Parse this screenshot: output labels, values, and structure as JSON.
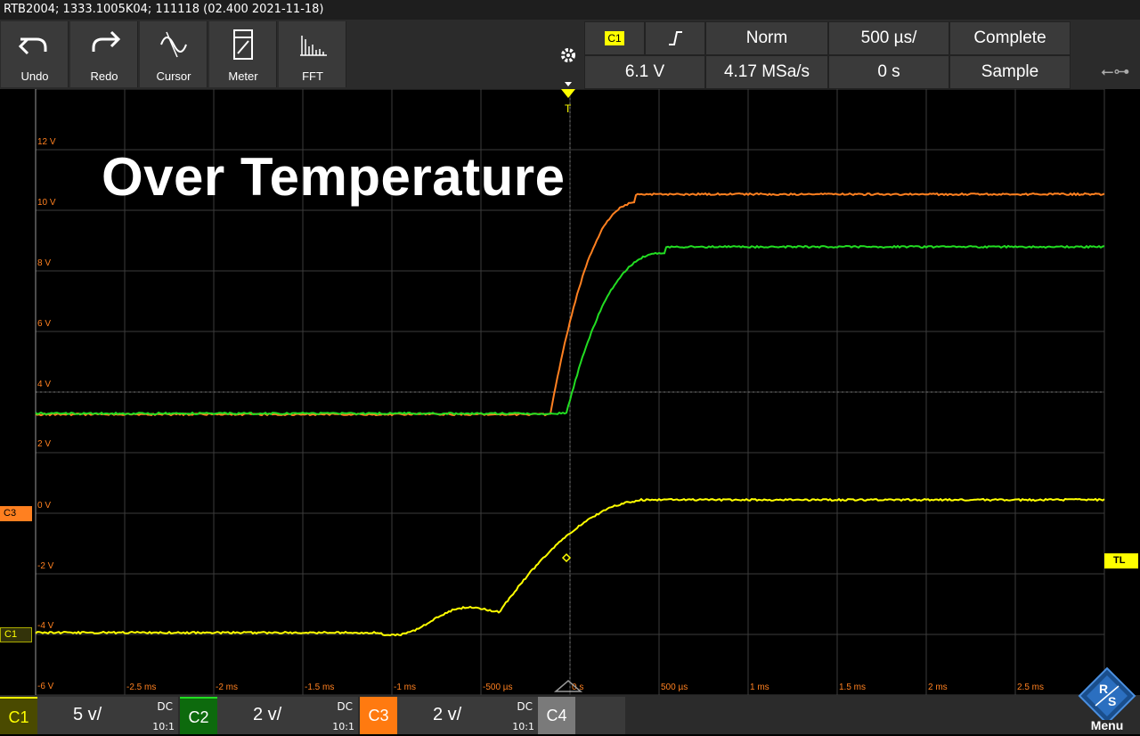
{
  "titlebar": {
    "text": "RTB2004; 1333.1005K04; 111118 (02.400 2021-11-18)"
  },
  "toolbar": {
    "buttons": [
      {
        "label": "Undo",
        "icon": "undo-icon"
      },
      {
        "label": "Redo",
        "icon": "redo-icon"
      },
      {
        "label": "Cursor",
        "icon": "cursor-icon"
      },
      {
        "label": "Meter",
        "icon": "meter-icon"
      },
      {
        "label": "FFT",
        "icon": "fft-icon"
      }
    ]
  },
  "acquisition": {
    "trigger_source": "C1",
    "trigger_level": "6.1 V",
    "mode": "Norm",
    "sample_rate": "4.17 MSa/s",
    "timebase": "500 µs/",
    "position": "0 s",
    "state": "Complete",
    "acq_mode": "Sample"
  },
  "overlay_title": "Over Temperature",
  "markers": {
    "c3": "C3",
    "c1": "C1",
    "trigger_level": "TL",
    "trigger": "T"
  },
  "y_labels": [
    "12 V",
    "10 V",
    "8 V",
    "6 V",
    "4 V",
    "2 V",
    "0 V",
    "-2 V",
    "-4 V",
    "-6 V"
  ],
  "x_labels": [
    "-2.5 ms",
    "-2 ms",
    "-1.5 ms",
    "-1 ms",
    "-500 µs",
    "0 s",
    "500 µs",
    "1 ms",
    "1.5 ms",
    "2 ms",
    "2.5 ms"
  ],
  "channels": [
    {
      "name": "C1",
      "scale": "5 v/",
      "coupling": "DC",
      "probe": "10:1",
      "color": "#e8e400"
    },
    {
      "name": "C2",
      "scale": "2 v/",
      "coupling": "DC",
      "probe": "10:1",
      "color": "#1ecf1e"
    },
    {
      "name": "C3",
      "scale": "2 v/",
      "coupling": "DC",
      "probe": "10:1",
      "color": "#ff7f1a"
    },
    {
      "name": "C4",
      "color": "#9a9a9a"
    }
  ],
  "menu_label": "Menu",
  "colors": {
    "c1": "#ffff00",
    "c2": "#22dd22",
    "c3": "#ff8020",
    "grid": "#555555",
    "trigger": "#ffff00"
  }
}
